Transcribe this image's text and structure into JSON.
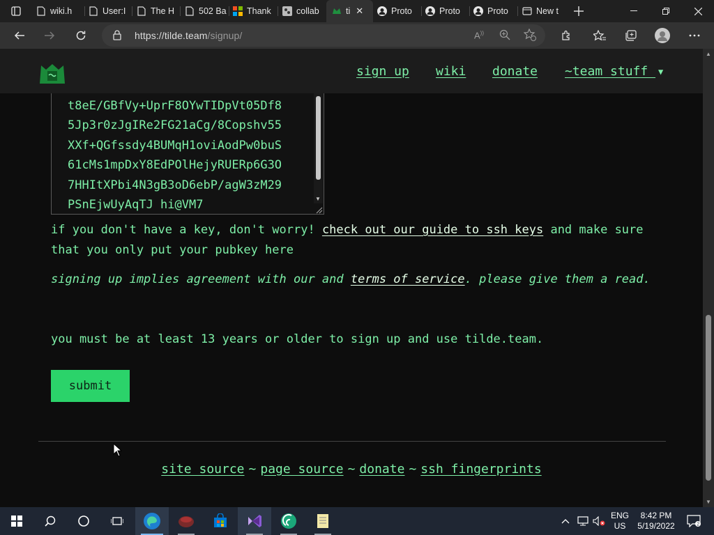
{
  "browser": {
    "tabs": [
      {
        "label": "wiki.h",
        "icon": "page-icon"
      },
      {
        "label": "User:I",
        "icon": "page-icon"
      },
      {
        "label": "The H",
        "icon": "page-icon"
      },
      {
        "label": "502 Ba",
        "icon": "page-icon"
      },
      {
        "label": "Thank",
        "icon": "microsoft-logo-icon"
      },
      {
        "label": "collab",
        "icon": "collab-icon"
      },
      {
        "label": "ti",
        "icon": "tilde-icon",
        "active": true
      },
      {
        "label": "Proto",
        "icon": "person-icon"
      },
      {
        "label": "Proto",
        "icon": "person-icon"
      },
      {
        "label": "Proto",
        "icon": "person-icon"
      },
      {
        "label": "New t",
        "icon": "newtab-icon"
      }
    ],
    "url_host": "https://tilde.team",
    "url_path": "/signup/"
  },
  "nav": {
    "signup": "sign up",
    "wiki": "wiki",
    "donate": "donate",
    "team": "~team stuff "
  },
  "key_lines": [
    "t8eE/GBfVy+UprF8OYwTIDpVt05Df8",
    "5Jp3r0zJgIRe2FG21aCg/8Copshv55",
    "XXf+QGfssdy4BUMqH1oviAodPw0buS",
    "61cMs1mpDxY8EdPOlHejyRUERp6G3O",
    "7HHItXPbi4N3gB3oD6ebP/agW3zM29",
    "PSnEjwUyAqTJ hi@VM7"
  ],
  "key_info": {
    "prefix": "if you don't have a key, don't worry! ",
    "link": "check out our guide to ssh keys",
    "suffix": " and make sure that you only put your pubkey here"
  },
  "agreement": {
    "prefix": "signing up implies agreement with our and ",
    "link": "terms of service",
    "suffix": ". please give them a read."
  },
  "age_notice": "you must be at least 13 years or older to sign up and use tilde.team.",
  "submit_label": "submit",
  "footer": {
    "site_source": "site source",
    "page_source": "page source",
    "donate": "donate",
    "ssh": "ssh fingerprints",
    "sep": "~"
  },
  "taskbar": {
    "lang": "ENG",
    "region": "US",
    "time": "8:42 PM",
    "date": "5/19/2022"
  },
  "colors": {
    "accent_green": "#7ef0a8",
    "button_green": "#2bd36a",
    "background": "#0d0d0d"
  }
}
